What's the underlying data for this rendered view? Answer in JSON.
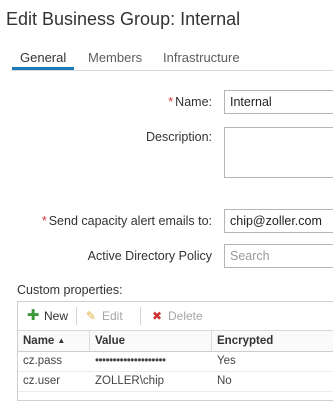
{
  "dialog": {
    "title": "Edit Business Group: Internal"
  },
  "tabs": [
    {
      "label": "General",
      "active": true
    },
    {
      "label": "Members",
      "active": false
    },
    {
      "label": "Infrastructure",
      "active": false
    }
  ],
  "form": {
    "name": {
      "label": "Name:",
      "value": "Internal",
      "required": true
    },
    "description": {
      "label": "Description:",
      "value": ""
    },
    "capacity_email": {
      "label": "Send capacity alert emails to:",
      "value": "chip@zoller.com",
      "required": true
    },
    "ad_policy": {
      "label": "Active Directory Policy",
      "value": "",
      "placeholder": "Search"
    }
  },
  "custom_properties": {
    "label": "Custom properties:",
    "toolbar": {
      "new_label": "New",
      "edit_label": "Edit",
      "delete_label": "Delete"
    },
    "columns": [
      "Name",
      "Value",
      "Encrypted"
    ],
    "sort_indicator": "▲",
    "rows": [
      {
        "name": "cz.pass",
        "value": "••••••••••••••••••••",
        "encrypted": "Yes"
      },
      {
        "name": "cz.user",
        "value": "ZOLLER\\chip",
        "encrypted": "No"
      }
    ]
  },
  "colors": {
    "accent": "#1a7ab8",
    "required": "#cc3333",
    "new_icon": "#3a9a3a",
    "delete_icon": "#cc3333",
    "edit_icon": "#e0b040"
  },
  "icons": {
    "new": "plus-icon",
    "edit": "pencil-icon",
    "delete": "x-icon",
    "sort": "sort-ascending-icon"
  }
}
